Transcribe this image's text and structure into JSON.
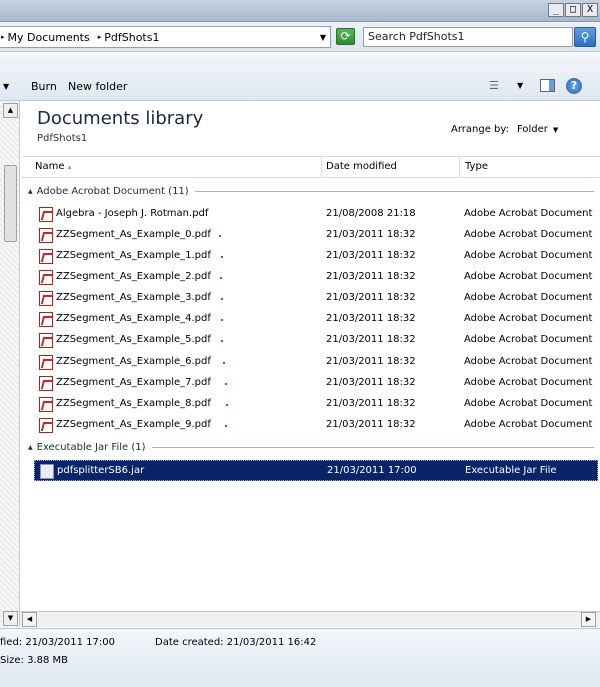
{
  "window": {
    "min_glyph": "_",
    "max_glyph": "□",
    "close_glyph": "X"
  },
  "address": {
    "crumbs": [
      "My Documents",
      "PdfShots1"
    ],
    "search_placeholder": "Search PdfShots1"
  },
  "toolbar": {
    "burn_label": "Burn",
    "new_folder_label": "New folder"
  },
  "library": {
    "title": "Documents library",
    "subtitle": "PdfShots1",
    "arrange_label": "Arrange by:",
    "arrange_value": "Folder"
  },
  "columns": {
    "name": "Name",
    "date": "Date modified",
    "type": "Type"
  },
  "groups": [
    {
      "label": "Adobe Acrobat Document (11)",
      "files": [
        {
          "name": "Algebra - Joseph J. Rotman.pdf",
          "date": "21/08/2008 21:18",
          "type": "Adobe Acrobat Document"
        },
        {
          "name": "ZZSegment_As_Example_0.pdf",
          "date": "21/03/2011 18:32",
          "type": "Adobe Acrobat Document"
        },
        {
          "name": "ZZSegment_As_Example_1.pdf",
          "date": "21/03/2011 18:32",
          "type": "Adobe Acrobat Document"
        },
        {
          "name": "ZZSegment_As_Example_2.pdf",
          "date": "21/03/2011 18:32",
          "type": "Adobe Acrobat Document"
        },
        {
          "name": "ZZSegment_As_Example_3.pdf",
          "date": "21/03/2011 18:32",
          "type": "Adobe Acrobat Document"
        },
        {
          "name": "ZZSegment_As_Example_4.pdf",
          "date": "21/03/2011 18:32",
          "type": "Adobe Acrobat Document"
        },
        {
          "name": "ZZSegment_As_Example_5.pdf",
          "date": "21/03/2011 18:32",
          "type": "Adobe Acrobat Document"
        },
        {
          "name": "ZZSegment_As_Example_6.pdf",
          "date": "21/03/2011 18:32",
          "type": "Adobe Acrobat Document"
        },
        {
          "name": "ZZSegment_As_Example_7.pdf",
          "date": "21/03/2011 18:32",
          "type": "Adobe Acrobat Document"
        },
        {
          "name": "ZZSegment_As_Example_8.pdf",
          "date": "21/03/2011 18:32",
          "type": "Adobe Acrobat Document"
        },
        {
          "name": "ZZSegment_As_Example_9.pdf",
          "date": "21/03/2011 18:32",
          "type": "Adobe Acrobat Document"
        }
      ]
    },
    {
      "label": "Executable Jar File (1)",
      "files": [
        {
          "name": "pdfsplitterSB6.jar",
          "date": "21/03/2011 17:00",
          "type": "Executable Jar File",
          "selected": true
        }
      ]
    }
  ],
  "details": {
    "modified_label": "fied:",
    "modified_value": "21/03/2011 17:00",
    "created_label": "Date created:",
    "created_value": "21/03/2011 16:42",
    "size_label": "Size:",
    "size_value": "3.88 MB"
  },
  "icons": {
    "refresh": "refresh-icon",
    "search": "search-icon",
    "views": "views-icon",
    "preview_pane": "preview-pane-icon",
    "help": "help-icon",
    "pdf": "pdf-file-icon",
    "jar": "jar-file-icon"
  },
  "colors": {
    "selection": "#0a246a",
    "pdf_red": "#c42828"
  }
}
